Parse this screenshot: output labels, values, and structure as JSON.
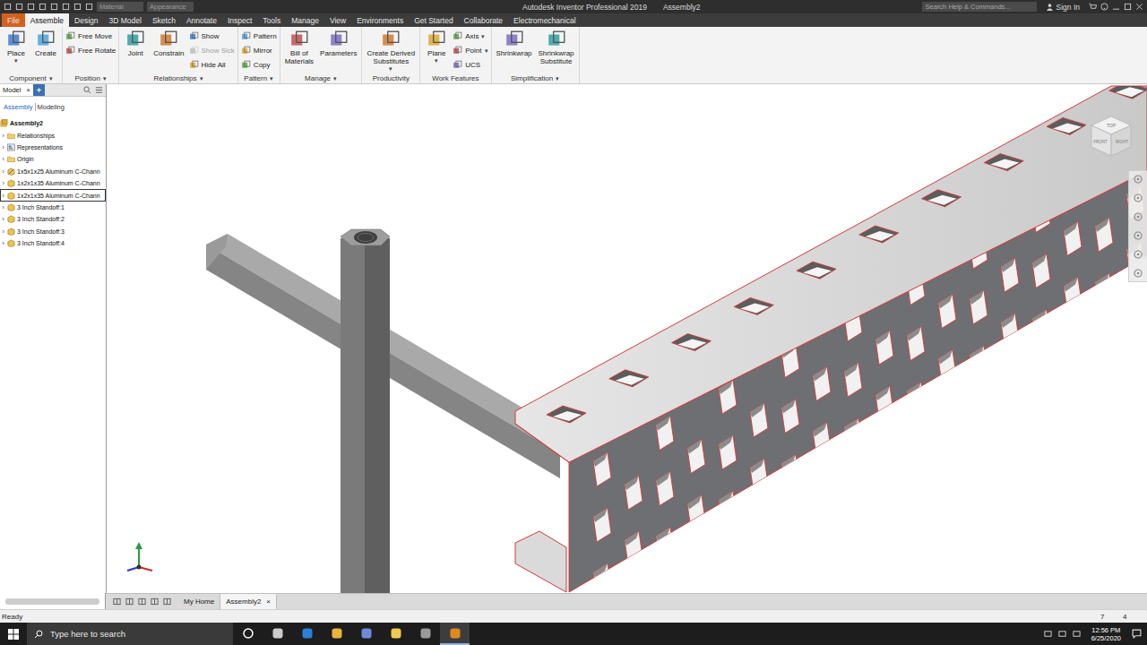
{
  "title_bar": {
    "fields": [
      "Material",
      "Appearance"
    ],
    "app_title": "Autodesk Inventor Professional 2019",
    "document": "Assembly2",
    "search_placeholder": "Search Help & Commands...",
    "sign_in": "Sign In"
  },
  "ribbon_tabs": [
    {
      "label": "File",
      "selected": false,
      "kind": "file"
    },
    {
      "label": "Assemble",
      "selected": true,
      "kind": "tab"
    },
    {
      "label": "Design",
      "selected": false,
      "kind": "tab"
    },
    {
      "label": "3D Model",
      "selected": false,
      "kind": "tab"
    },
    {
      "label": "Sketch",
      "selected": false,
      "kind": "tab"
    },
    {
      "label": "Annotate",
      "selected": false,
      "kind": "tab"
    },
    {
      "label": "Inspect",
      "selected": false,
      "kind": "tab"
    },
    {
      "label": "Tools",
      "selected": false,
      "kind": "tab"
    },
    {
      "label": "Manage",
      "selected": false,
      "kind": "tab"
    },
    {
      "label": "View",
      "selected": false,
      "kind": "tab"
    },
    {
      "label": "Environments",
      "selected": false,
      "kind": "tab"
    },
    {
      "label": "Get Started",
      "selected": false,
      "kind": "tab"
    },
    {
      "label": "Collaborate",
      "selected": false,
      "kind": "tab"
    },
    {
      "label": "Electromechanical",
      "selected": false,
      "kind": "tab"
    }
  ],
  "dropdown_glyph": "▾",
  "ribbon_groups": [
    {
      "label": "Component",
      "dropdown": true,
      "tools": [
        {
          "lines": [
            "Place"
          ],
          "kind": "large",
          "dropdown": true,
          "disabled": false
        },
        {
          "lines": [
            "Create"
          ],
          "kind": "large",
          "dropdown": false,
          "disabled": false
        }
      ]
    },
    {
      "label": "Position",
      "dropdown": true,
      "tools": [
        {
          "lines": [
            "Free Move"
          ],
          "kind": "small",
          "dropdown": false,
          "disabled": false
        },
        {
          "lines": [
            "Free Rotate"
          ],
          "kind": "small",
          "dropdown": false,
          "disabled": false
        }
      ]
    },
    {
      "label": "Relationships",
      "dropdown": true,
      "tools": [
        {
          "lines": [
            "Joint"
          ],
          "kind": "large",
          "dropdown": false,
          "disabled": false
        },
        {
          "lines": [
            "Constrain"
          ],
          "kind": "large",
          "dropdown": false,
          "disabled": false
        },
        {
          "lines": [
            "Show"
          ],
          "kind": "small",
          "dropdown": false,
          "disabled": false
        },
        {
          "lines": [
            "Show Sick"
          ],
          "kind": "small",
          "dropdown": false,
          "disabled": true
        },
        {
          "lines": [
            "Hide All"
          ],
          "kind": "small",
          "dropdown": false,
          "disabled": false
        }
      ]
    },
    {
      "label": "Pattern",
      "dropdown": true,
      "tools": [
        {
          "lines": [
            "Pattern"
          ],
          "kind": "small",
          "dropdown": false,
          "disabled": false
        },
        {
          "lines": [
            "Mirror"
          ],
          "kind": "small",
          "dropdown": false,
          "disabled": false
        },
        {
          "lines": [
            "Copy"
          ],
          "kind": "small",
          "dropdown": false,
          "disabled": false
        }
      ]
    },
    {
      "label": "Manage",
      "dropdown": true,
      "tools": [
        {
          "lines": [
            "Bill of",
            "Materials"
          ],
          "kind": "large",
          "dropdown": false,
          "disabled": false
        },
        {
          "lines": [
            "Parameters"
          ],
          "kind": "large",
          "dropdown": false,
          "disabled": false
        }
      ]
    },
    {
      "label": "Productivity",
      "dropdown": false,
      "tools": [
        {
          "lines": [
            "Create Derived",
            "Substitutes"
          ],
          "kind": "large",
          "dropdown": true,
          "disabled": false
        }
      ]
    },
    {
      "label": "Work Features",
      "dropdown": false,
      "tools": [
        {
          "lines": [
            "Plane"
          ],
          "kind": "large",
          "dropdown": true,
          "disabled": false
        },
        {
          "lines": [
            "Axis"
          ],
          "kind": "small",
          "dropdown": true,
          "disabled": false
        },
        {
          "lines": [
            "Point"
          ],
          "kind": "small",
          "dropdown": true,
          "disabled": false
        },
        {
          "lines": [
            "UCS"
          ],
          "kind": "small",
          "dropdown": false,
          "disabled": false
        }
      ]
    },
    {
      "label": "Simplification",
      "dropdown": true,
      "tools": [
        {
          "lines": [
            "Shrinkwrap"
          ],
          "kind": "large",
          "dropdown": false,
          "disabled": false
        },
        {
          "lines": [
            "Shrinkwrap",
            "Substitute"
          ],
          "kind": "large",
          "dropdown": false,
          "disabled": false
        }
      ]
    }
  ],
  "browser": {
    "tab": "Model",
    "close": "×",
    "add": "+",
    "modes": [
      {
        "label": "Assembly",
        "selected": true
      },
      {
        "label": "Modeling",
        "selected": false
      }
    ],
    "collapsed_glyph": "›",
    "items": [
      {
        "label": "Assembly2",
        "kind": "root",
        "expandable": false,
        "selected": false
      },
      {
        "label": "Relationships",
        "kind": "folder",
        "expandable": true,
        "selected": false
      },
      {
        "label": "Representations",
        "kind": "representations",
        "expandable": true,
        "selected": false
      },
      {
        "label": "Origin",
        "kind": "folder",
        "expandable": true,
        "selected": false
      },
      {
        "label": "1x5x1x25 Aluminum C-Chann",
        "kind": "adaptive-part",
        "expandable": true,
        "selected": false
      },
      {
        "label": "1x2x1x35 Aluminum C-Chann",
        "kind": "part",
        "expandable": true,
        "selected": false
      },
      {
        "label": "1x2x1x35 Aluminum C-Chann",
        "kind": "part",
        "expandable": true,
        "selected": true
      },
      {
        "label": "3 Inch Standoff:1",
        "kind": "part",
        "expandable": true,
        "selected": false
      },
      {
        "label": "3 Inch Standoff:2",
        "kind": "part",
        "expandable": true,
        "selected": false
      },
      {
        "label": "3 Inch Standoff:3",
        "kind": "part",
        "expandable": true,
        "selected": false
      },
      {
        "label": "3 Inch Standoff:4",
        "kind": "part",
        "expandable": true,
        "selected": false
      }
    ]
  },
  "viewcube": {
    "top": "TOP",
    "front": "FRONT",
    "right": "RIGHT"
  },
  "doc_tabs": [
    {
      "label": "My Home",
      "selected": false,
      "closable": false
    },
    {
      "label": "Assembly2",
      "selected": true,
      "closable": true
    }
  ],
  "close_glyph": "×",
  "status_bar": {
    "text": "Ready",
    "counts": [
      "7",
      "4"
    ]
  },
  "taskbar": {
    "search_placeholder": "Type here to search",
    "time": "12:56 PM",
    "date": "6/25/2020"
  }
}
